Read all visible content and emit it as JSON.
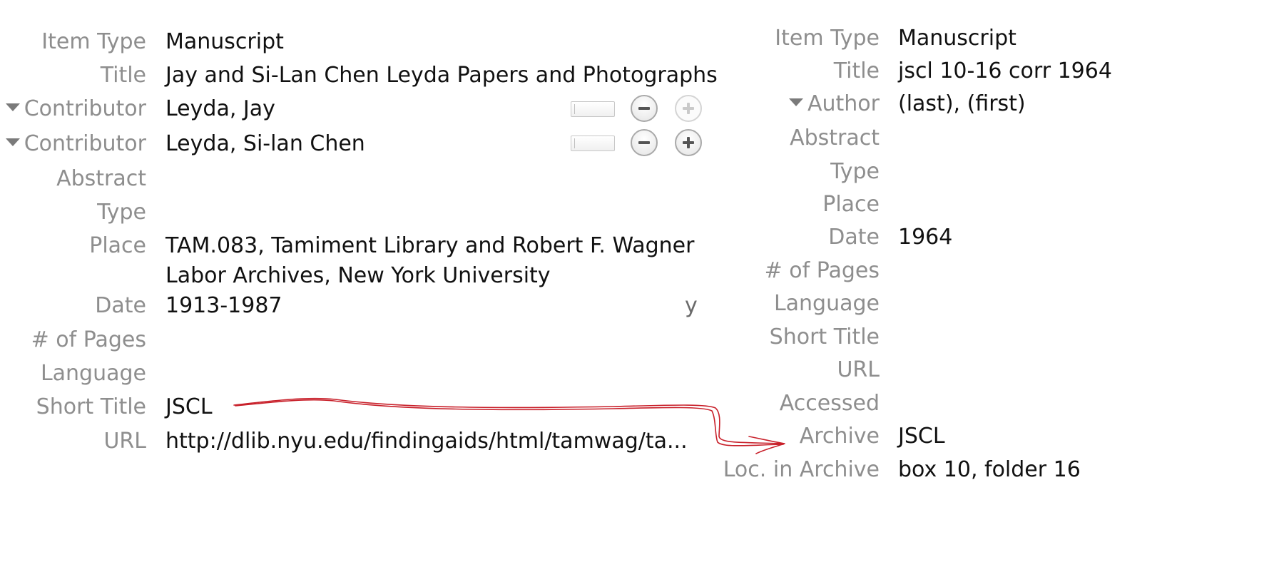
{
  "left_panel": {
    "fields": [
      {
        "label": "Item Type",
        "value": "Manuscript"
      },
      {
        "label": "Title",
        "value": "Jay and Si-Lan Chen Leyda Papers and Photographs"
      },
      {
        "label": "Contributor",
        "value": "Leyda, Jay"
      },
      {
        "label": "Contributor",
        "value": "Leyda, Si-lan Chen"
      },
      {
        "label": "Abstract",
        "value": ""
      },
      {
        "label": "Type",
        "value": ""
      },
      {
        "label": "Place",
        "value": "TAM.083, Tamiment Library and Robert F. Wagner Labor Archives, New York University"
      },
      {
        "label": "Date",
        "value": "1913-1987",
        "suffix": "y"
      },
      {
        "label": "# of Pages",
        "value": ""
      },
      {
        "label": "Language",
        "value": ""
      },
      {
        "label": "Short Title",
        "value": "JSCL"
      },
      {
        "label": "URL",
        "value": "http://dlib.nyu.edu/findingaids/html/tamwag/ta..."
      }
    ]
  },
  "right_panel": {
    "fields": [
      {
        "label": "Item Type",
        "value": "Manuscript"
      },
      {
        "label": "Title",
        "value": "jscl 10-16 corr 1964"
      },
      {
        "label": "Author",
        "value": "(last), (first)"
      },
      {
        "label": "Abstract",
        "value": ""
      },
      {
        "label": "Type",
        "value": ""
      },
      {
        "label": "Place",
        "value": ""
      },
      {
        "label": "Date",
        "value": "1964"
      },
      {
        "label": "# of Pages",
        "value": ""
      },
      {
        "label": "Language",
        "value": ""
      },
      {
        "label": "Short Title",
        "value": ""
      },
      {
        "label": "URL",
        "value": ""
      },
      {
        "label": "Accessed",
        "value": ""
      },
      {
        "label": "Archive",
        "value": "JSCL"
      },
      {
        "label": "Loc. in Archive",
        "value": "box 10, folder 16"
      }
    ]
  },
  "annotation": {
    "arrow_color": "#c8202a",
    "meaning": "Short Title to Archive"
  }
}
